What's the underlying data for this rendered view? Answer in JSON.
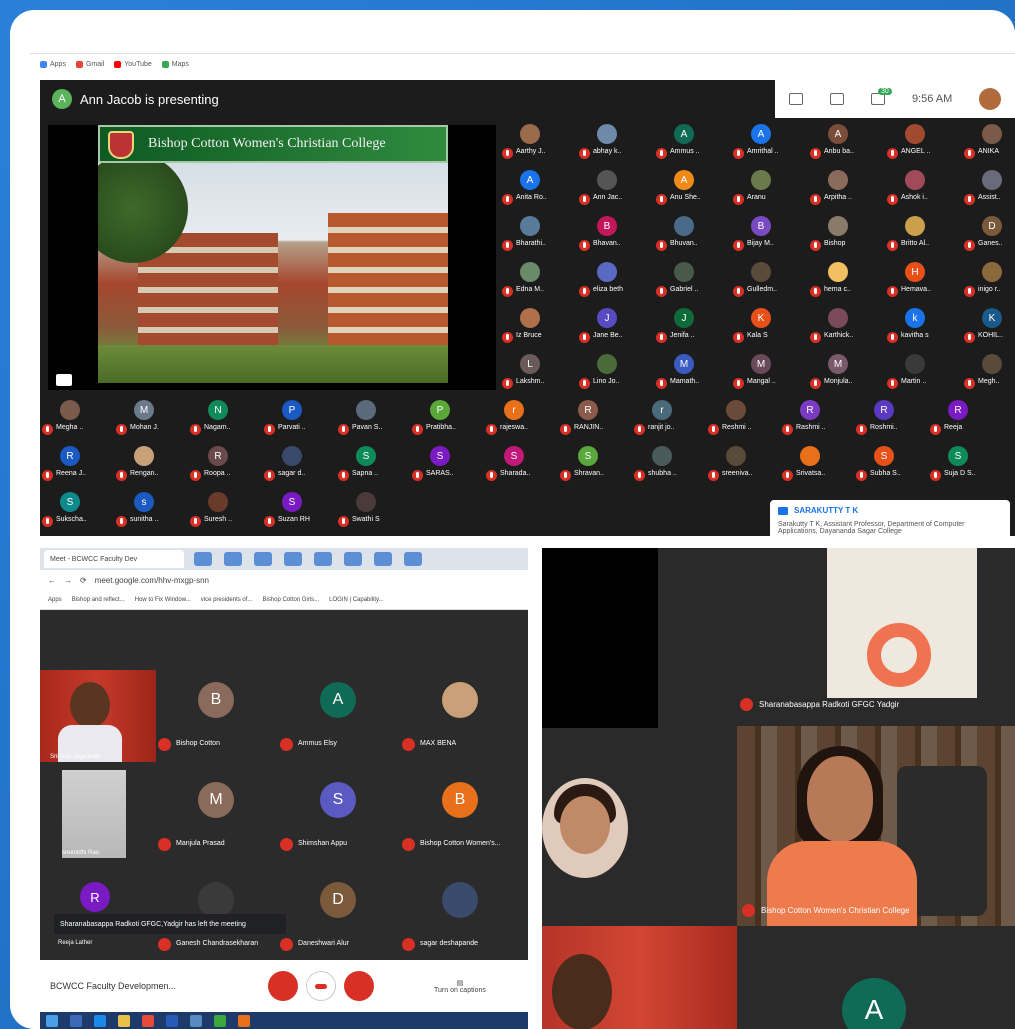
{
  "presenter": {
    "initial": "A",
    "text": "Ann Jacob is presenting"
  },
  "top_right": {
    "time": "9:56 AM",
    "chat_badge": "30"
  },
  "bookmarks": [
    "Apps",
    "Gmail",
    "YouTube",
    "Maps"
  ],
  "slide": {
    "title": "Bishop Cotton Women's Christian College"
  },
  "participants_top": [
    {
      "name": "Aarthy J..",
      "color": "#9a6b4a",
      "initial": ""
    },
    {
      "name": "abhay k..",
      "color": "#6d8aa8",
      "initial": ""
    },
    {
      "name": "Ammus ..",
      "color": "#0f6b56",
      "initial": "A"
    },
    {
      "name": "Amrithal ..",
      "color": "#1a73e8",
      "initial": "A"
    },
    {
      "name": "Anbu ba..",
      "color": "#7a4d3a",
      "initial": "A"
    },
    {
      "name": "ANGEL ..",
      "color": "#a14a2f",
      "initial": ""
    },
    {
      "name": "ANIKA",
      "color": "#7b5a4a",
      "initial": ""
    },
    {
      "name": "Anita Ro..",
      "color": "#1a73e8",
      "initial": "A"
    },
    {
      "name": "Ann Jac..",
      "color": "#555",
      "initial": ""
    },
    {
      "name": "Anu She..",
      "color": "#ef8a1a",
      "initial": "A"
    },
    {
      "name": "Aranu",
      "color": "#6b7a4a",
      "initial": ""
    },
    {
      "name": "Arpitha ..",
      "color": "#8a6a5a",
      "initial": ""
    },
    {
      "name": "Ashok i..",
      "color": "#a14a5a",
      "initial": ""
    },
    {
      "name": "Assist..",
      "color": "#6a6a7a",
      "initial": ""
    },
    {
      "name": "Bharathi..",
      "color": "#5a7a9a",
      "initial": ""
    },
    {
      "name": "Bhavan..",
      "color": "#c2185b",
      "initial": "B"
    },
    {
      "name": "Bhuvan..",
      "color": "#4a6a8a",
      "initial": ""
    },
    {
      "name": "Bijay M..",
      "color": "#7a4ac2",
      "initial": "B"
    },
    {
      "name": "Bishop",
      "color": "#8a7a6a",
      "initial": ""
    },
    {
      "name": "Britto Al..",
      "color": "#caa04a",
      "initial": ""
    },
    {
      "name": "Ganes..",
      "color": "#7a5a3a",
      "initial": "D"
    },
    {
      "name": "Edna M..",
      "color": "#6a8a6a",
      "initial": ""
    },
    {
      "name": "eliza beth",
      "color": "#5a6ac2",
      "initial": ""
    },
    {
      "name": "Gabriel ..",
      "color": "#4a5a4a",
      "initial": ""
    },
    {
      "name": "Gulledm..",
      "color": "#5a4a3a",
      "initial": ""
    },
    {
      "name": "hema c..",
      "color": "#f0c060",
      "initial": ""
    },
    {
      "name": "Hemava..",
      "color": "#e8501a",
      "initial": "H"
    },
    {
      "name": "inigo r..",
      "color": "#8a6a3a",
      "initial": ""
    },
    {
      "name": "Iz Bruce",
      "color": "#b0704a",
      "initial": ""
    },
    {
      "name": "Jane Be..",
      "color": "#5a4ac2",
      "initial": "J"
    },
    {
      "name": "Jenifa ..",
      "color": "#0f6b3a",
      "initial": "J"
    },
    {
      "name": "Kala S",
      "color": "#e8501a",
      "initial": "K"
    },
    {
      "name": "Karthick..",
      "color": "#7a4a5a",
      "initial": ""
    },
    {
      "name": "kavitha s",
      "color": "#1a73e8",
      "initial": "k"
    },
    {
      "name": "KOHIL..",
      "color": "#1a5a8a",
      "initial": "K"
    },
    {
      "name": "Lakshm..",
      "color": "#6a5a5a",
      "initial": "L"
    },
    {
      "name": "Lino Jo..",
      "color": "#4a6a3a",
      "initial": ""
    },
    {
      "name": "Mamath..",
      "color": "#3a5ac2",
      "initial": "M"
    },
    {
      "name": "Mangal ..",
      "color": "#6a4a5a",
      "initial": "M"
    },
    {
      "name": "Monjula..",
      "color": "#7a5a6a",
      "initial": "M"
    },
    {
      "name": "Martin ..",
      "color": "#3a3a3a",
      "initial": ""
    },
    {
      "name": "Megh..",
      "color": "#5a4a3a",
      "initial": ""
    }
  ],
  "participants_strip": [
    {
      "name": "Megha ..",
      "color": "#7a5a4a",
      "initial": ""
    },
    {
      "name": "Mohan J.",
      "color": "#6a7a8a",
      "initial": "M"
    },
    {
      "name": "Nagam..",
      "color": "#0f8a5a",
      "initial": "N"
    },
    {
      "name": "Parvati ..",
      "color": "#1a5ac2",
      "initial": "P"
    },
    {
      "name": "Pavan S..",
      "color": "#5a6a7a",
      "initial": ""
    },
    {
      "name": "Pratibha..",
      "color": "#5aa83a",
      "initial": "P"
    },
    {
      "name": "rajeswa..",
      "color": "#e8701a",
      "initial": "r"
    },
    {
      "name": "RANJIN..",
      "color": "#8a5a4a",
      "initial": "R"
    },
    {
      "name": "ranjit jo..",
      "color": "#4a6a7a",
      "initial": "r"
    },
    {
      "name": "Reshmi ..",
      "color": "#6a4a3a",
      "initial": ""
    },
    {
      "name": "Rashmi ..",
      "color": "#7a3ac2",
      "initial": "R"
    },
    {
      "name": "Roshmi..",
      "color": "#5a3ac2",
      "initial": "R"
    },
    {
      "name": "Reeja",
      "color": "#7a1ac2",
      "initial": "R"
    },
    {
      "name": "Reena J..",
      "color": "#1a5ac2",
      "initial": "R"
    },
    {
      "name": "Rengan..",
      "color": "#caa07a",
      "initial": ""
    },
    {
      "name": "Roopa ..",
      "color": "#6a4a4a",
      "initial": "R"
    },
    {
      "name": "sagar d..",
      "color": "#3a4a6a",
      "initial": ""
    },
    {
      "name": "Sapna ..",
      "color": "#0f8a5a",
      "initial": "S"
    },
    {
      "name": "SARAS..",
      "color": "#7a1ac2",
      "initial": "S"
    },
    {
      "name": "Sharada..",
      "color": "#c2187a",
      "initial": "S"
    },
    {
      "name": "Shravan..",
      "color": "#5aa83a",
      "initial": "S"
    },
    {
      "name": "shubha ..",
      "color": "#4a5a5a",
      "initial": ""
    },
    {
      "name": "sreenivа..",
      "color": "#5a4a3a",
      "initial": ""
    },
    {
      "name": "Srivatsa..",
      "color": "#e8701a",
      "initial": ""
    },
    {
      "name": "Subha S..",
      "color": "#e8501a",
      "initial": "S"
    },
    {
      "name": "Suja D S..",
      "color": "#0f8a5a",
      "initial": "S"
    },
    {
      "name": "Sukscha..",
      "color": "#0f8a8a",
      "initial": "S"
    },
    {
      "name": "sunitha ..",
      "color": "#1a5ac2",
      "initial": "s"
    },
    {
      "name": "Suresh ..",
      "color": "#6a3a2a",
      "initial": ""
    },
    {
      "name": "Suzan RH",
      "color": "#7a1ac2",
      "initial": "S"
    },
    {
      "name": "Swathi S",
      "color": "#4a3a3a",
      "initial": ""
    }
  ],
  "tooltip": {
    "title": "SARAKUTTY T K",
    "text": "Sarakutty T K, Assistant Professor, Department of Computer Applications, Dayananda Sagar College"
  },
  "bottom_left": {
    "tab_title": "Meet - BCWCC Faculty Dev",
    "url": "meet.google.com/hhv-mxgp-snn",
    "bookmarks": [
      "Apps",
      "Bishop and reflect...",
      "How to Fix Window...",
      "vice presidents of...",
      "Bishop Cotton Girls...",
      "LOGIN | Capability..."
    ],
    "tiles": [
      {
        "name": "Bishop Cotton",
        "initial": "B",
        "color": "#8a6a5a"
      },
      {
        "name": "Ammus Elsy",
        "initial": "A",
        "color": "#0f6b56"
      },
      {
        "name": "MAX BENA",
        "initial": "",
        "color": "#caa07a"
      },
      {
        "name": "Manjula Prasad",
        "initial": "M",
        "color": "#8a6a5a"
      },
      {
        "name": "Shimshan Appu",
        "initial": "S",
        "color": "#5a5ac2"
      },
      {
        "name": "Bishop Cotton Women's...",
        "initial": "B",
        "color": "#e8701a"
      },
      {
        "name": "Ganesh Chandrasekharan",
        "initial": "",
        "color": "#3a3a3a"
      },
      {
        "name": "Daneshwari Alur",
        "initial": "D",
        "color": "#7a5a3a"
      },
      {
        "name": "sagar deshapande",
        "initial": "",
        "color": "#3a4a6a"
      }
    ],
    "video_name": "Srinivas Jagannath",
    "gray_video_name": "sreenidhi Rao",
    "partial_tile_name": "Reeja Lather",
    "notice": "Sharanabasappa Radkoti GFGC,Yadgir has left the meeting",
    "meeting_name": "BCWCC Faculty Developmen...",
    "captions": "Turn on captions"
  },
  "bottom_right": {
    "label_top": "Sharanabasappa Radkoti GFGC Yadgir",
    "label_bottom": "Bishop Cotton Women's Christian College",
    "avatar_initial": "A"
  }
}
